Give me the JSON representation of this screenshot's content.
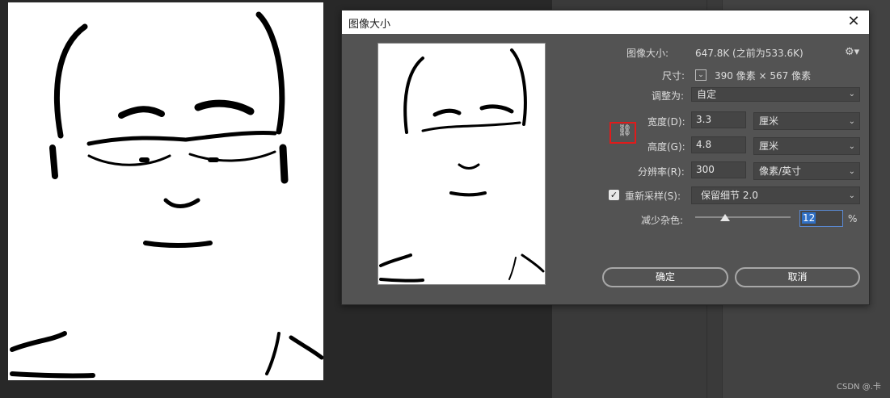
{
  "dialog": {
    "title": "图像大小",
    "close_glyph": "✕",
    "image_size_label": "图像大小:",
    "image_size_value": "647.8K (之前为533.6K)",
    "dimensions_label": "尺寸:",
    "dimensions_value": "390 像素 × 567 像素",
    "fit_to_label": "调整为:",
    "fit_to_value": "自定",
    "width_label": "宽度(D):",
    "width_value": "3.3",
    "width_unit": "厘米",
    "height_label": "高度(G):",
    "height_value": "4.8",
    "height_unit": "厘米",
    "resolution_label": "分辨率(R):",
    "resolution_value": "300",
    "resolution_unit": "像素/英寸",
    "resample_label": "重新采样(S):",
    "resample_value": "保留细节 2.0",
    "resample_checked": true,
    "reduce_noise_label": "减少杂色:",
    "reduce_noise_value": "12",
    "reduce_noise_unit": "%",
    "reduce_noise_level_percent": 12,
    "ok_label": "确定",
    "cancel_label": "取消"
  },
  "icons": {
    "gear": "gear-icon",
    "link": "link-constrain-icon",
    "chevron": "chevron-down-icon",
    "close": "close-icon"
  },
  "colors": {
    "dialog_bg": "#535353",
    "highlight_box": "#e01b1b",
    "selection": "#2f6fc4"
  },
  "watermark": "CSDN @.卡"
}
